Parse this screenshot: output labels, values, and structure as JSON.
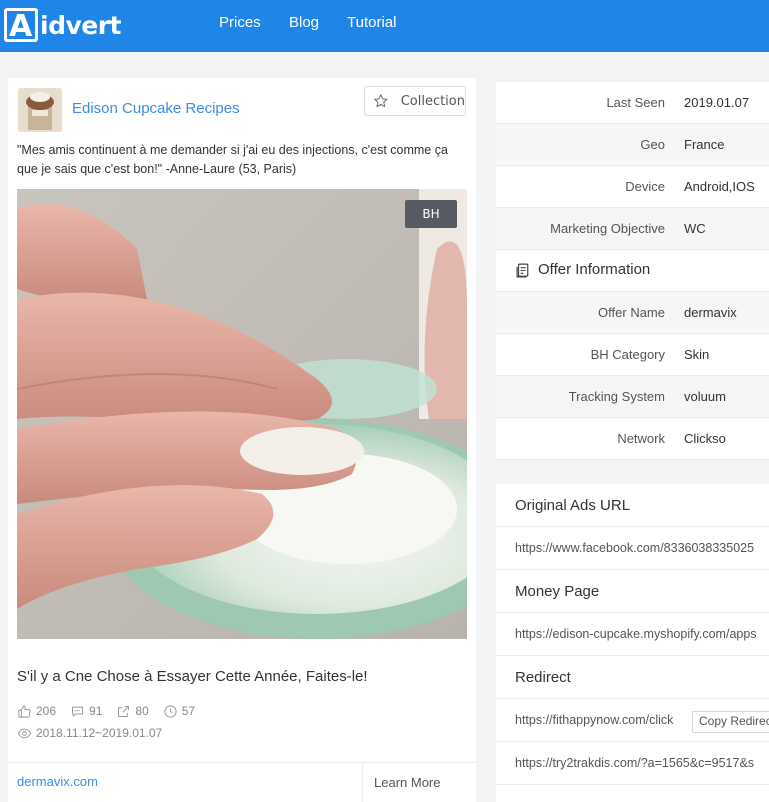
{
  "header": {
    "logo_text": "idvert",
    "logo_mark": "A",
    "nav": [
      "Prices",
      "Blog",
      "Tutorial"
    ]
  },
  "ad": {
    "page_name": "Edison Cupcake Recipes",
    "collection_label": "Collection",
    "text": "\"Mes amis continuent à me demander si j'ai eu des injections, c'est comme ça que je sais que c'est bon!\" -Anne-Laure (53, Paris)",
    "badge": "BH",
    "headline": "S'il y a Cne Chose à Essayer Cette Année, Faites-le!",
    "stats": {
      "likes": "206",
      "comments": "91",
      "shares": "80",
      "duration": "57"
    },
    "date_range": "2018.11.12~2019.01.07",
    "domain": "dermavix.com",
    "cta": "Learn More"
  },
  "details": {
    "rows": [
      {
        "label": "Last Seen",
        "value": "2019.01.07"
      },
      {
        "label": "Geo",
        "value": "France"
      },
      {
        "label": "Device",
        "value": "Android,IOS"
      },
      {
        "label": "Marketing Objective",
        "value": "WC"
      }
    ]
  },
  "offer": {
    "title": "Offer Information",
    "rows": [
      {
        "label": "Offer Name",
        "value": "dermavix"
      },
      {
        "label": "BH Category",
        "value": "Skin"
      },
      {
        "label": "Tracking System",
        "value": "voluum"
      },
      {
        "label": "Network",
        "value": "Clickso"
      }
    ]
  },
  "urls": {
    "original_title": "Original Ads URL",
    "original_url": "https://www.facebook.com/8336038335025",
    "money_title": "Money Page",
    "money_url": "https://edison-cupcake.myshopify.com/apps",
    "redirect_title": "Redirect",
    "redirect_1": "https://fithappynow.com/click",
    "copy_redirect": "Copy Redirect",
    "redirect_2": "https://try2trakdis.com/?a=1565&c=9517&s"
  },
  "colors": {
    "brand": "#1f86e8",
    "link": "#3a8ee6",
    "badge_bg": "#555a63"
  }
}
